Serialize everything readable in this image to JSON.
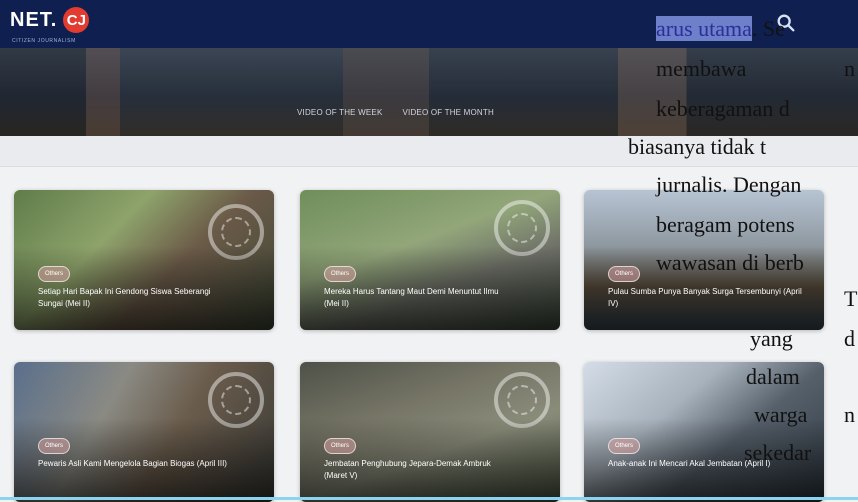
{
  "header": {
    "logo_text": "NET.",
    "logo_badge": "CJ",
    "logo_subtitle": "CITIZEN JOURNALISM"
  },
  "hero": {
    "tabs": [
      "VIDEO OF THE WEEK",
      "VIDEO OF THE MONTH"
    ]
  },
  "cards": [
    {
      "category": "Others",
      "title": "Setiap Hari Bapak Ini Gendong Siswa Seberangi Sungai (Mei II)"
    },
    {
      "category": "Others",
      "title": "Mereka Harus Tantang Maut Demi Menuntut Ilmu (Mei II)"
    },
    {
      "category": "Others",
      "title": "Pulau Sumba Punya Banyak Surga Tersembunyi (April IV)"
    },
    {
      "category": "Others",
      "title": "Pewaris Asli Kami Mengelola Bagian Biogas (April III)"
    },
    {
      "category": "Others",
      "title": "Jembatan Penghubung Jepara-Demak Ambruk (Maret V)"
    },
    {
      "category": "Others",
      "title": "Anak-anak Ini Mencari Akal Jembatan (April I)"
    }
  ],
  "overlay_text": {
    "line1_a": "arus utama",
    "line1_b": ". Se",
    "line2_a": "membawa",
    "line2_b": "n",
    "line3": "keberagaman d",
    "line4": "biasanya tidak t",
    "line5": "jurnalis. Dengan",
    "line6": "beragam potens",
    "line7": "wawasan di berb",
    "line8": "T",
    "line9_a": "yang",
    "line9_b": "d",
    "line10": "dalam",
    "line11_a": "warga",
    "line11_b": "n",
    "line12": "sekedar"
  },
  "icons": {
    "search": "search-icon"
  },
  "colors": {
    "header": "#0f2050",
    "logo_red": "#e23b2f",
    "selection": "#6e80c9"
  }
}
